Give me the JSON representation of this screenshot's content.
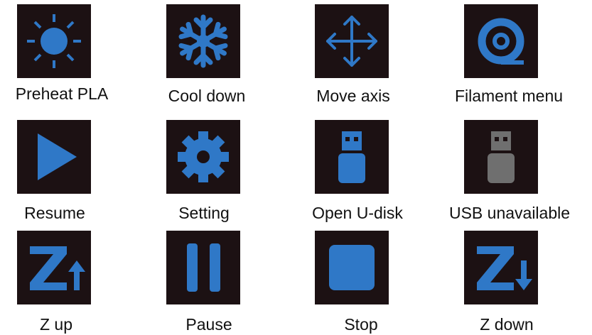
{
  "accent_color": "#2f78c7",
  "disabled_color": "#6f6f6f",
  "tile_background": "#1c1113",
  "buttons": [
    {
      "label": "Preheat PLA",
      "icon": "sun-icon"
    },
    {
      "label": "Cool down",
      "icon": "snowflake-icon"
    },
    {
      "label": "Move axis",
      "icon": "move-arrows-icon"
    },
    {
      "label": "Filament menu",
      "icon": "filament-spool-icon"
    },
    {
      "label": "Resume",
      "icon": "play-icon"
    },
    {
      "label": "Setting",
      "icon": "gear-icon"
    },
    {
      "label": "Open U-disk",
      "icon": "usb-drive-icon"
    },
    {
      "label": "USB unavailable",
      "icon": "usb-drive-disabled-icon"
    },
    {
      "label": "Z up",
      "icon": "z-up-icon"
    },
    {
      "label": "Pause",
      "icon": "pause-icon"
    },
    {
      "label": "Stop",
      "icon": "stop-icon"
    },
    {
      "label": "Z down",
      "icon": "z-down-icon"
    }
  ]
}
